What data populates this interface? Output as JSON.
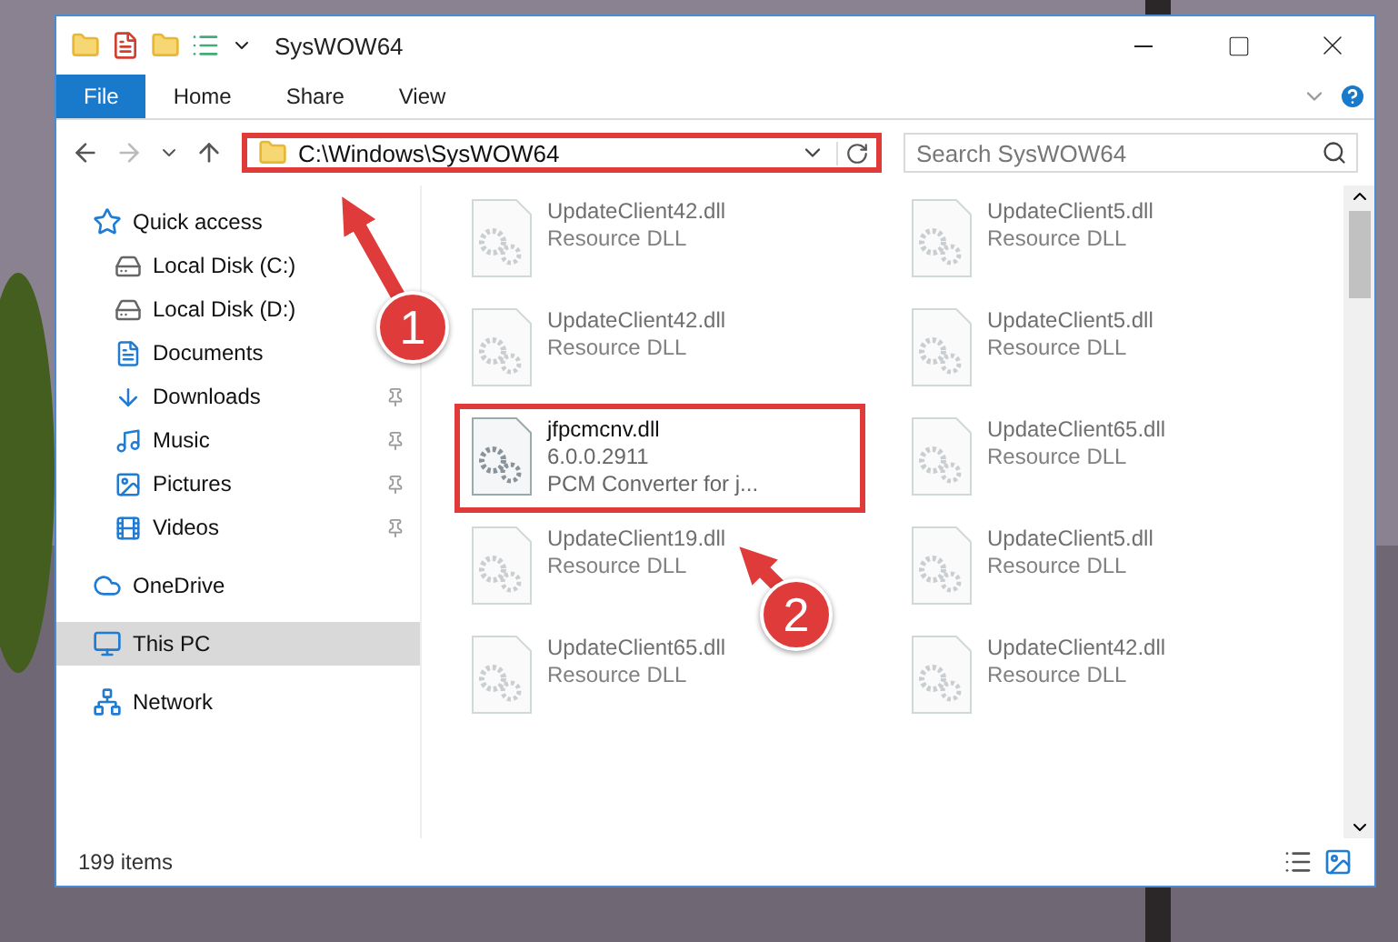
{
  "window": {
    "title": "SysWOW64"
  },
  "ribbon_tabs": [
    {
      "label": "File",
      "selected": true
    },
    {
      "label": "Home",
      "selected": false
    },
    {
      "label": "Share",
      "selected": false
    },
    {
      "label": "View",
      "selected": false
    }
  ],
  "address_bar": {
    "path": "C:\\Windows\\SysWOW64",
    "highlighted": true
  },
  "search": {
    "placeholder": "Search SysWOW64"
  },
  "navigation": [
    {
      "label": "Quick access",
      "selected": false,
      "children": [
        {
          "label": "Local Disk (C:)",
          "selected": false,
          "pinned": false
        },
        {
          "label": "Local Disk (D:)",
          "selected": false,
          "pinned": false
        },
        {
          "label": "Documents",
          "selected": false,
          "pinned": false
        },
        {
          "label": "Downloads",
          "selected": false,
          "pinned": true
        },
        {
          "label": "Music",
          "selected": false,
          "pinned": true
        },
        {
          "label": "Pictures",
          "selected": false,
          "pinned": true
        },
        {
          "label": "Videos",
          "selected": false,
          "pinned": true
        }
      ]
    },
    {
      "label": "OneDrive",
      "selected": false
    },
    {
      "label": "This PC",
      "selected": true
    },
    {
      "label": "Network",
      "selected": false
    }
  ],
  "files": [
    {
      "name": "UpdateClient42.dll",
      "details": [
        "Resource DLL"
      ],
      "blurred": true,
      "highlighted": false
    },
    {
      "name": "UpdateClient5.dll",
      "details": [
        "Resource DLL"
      ],
      "blurred": true,
      "highlighted": false
    },
    {
      "name": "UpdateClient42.dll",
      "details": [
        "Resource DLL"
      ],
      "blurred": true,
      "highlighted": false
    },
    {
      "name": "UpdateClient5.dll",
      "details": [
        "Resource DLL"
      ],
      "blurred": true,
      "highlighted": false
    },
    {
      "name": "jfpcmcnv.dll",
      "details": [
        "6.0.0.2911",
        "PCM Converter for j..."
      ],
      "blurred": false,
      "highlighted": true
    },
    {
      "name": "UpdateClient65.dll",
      "details": [
        "Resource DLL"
      ],
      "blurred": true,
      "highlighted": false
    },
    {
      "name": "UpdateClient19.dll",
      "details": [
        "Resource DLL"
      ],
      "blurred": true,
      "highlighted": false
    },
    {
      "name": "UpdateClient5.dll",
      "details": [
        "Resource DLL"
      ],
      "blurred": true,
      "highlighted": false
    },
    {
      "name": "UpdateClient65.dll",
      "details": [
        "Resource DLL"
      ],
      "blurred": true,
      "highlighted": false
    },
    {
      "name": "UpdateClient42.dll",
      "details": [
        "Resource DLL"
      ],
      "blurred": true,
      "highlighted": false
    }
  ],
  "status_bar": {
    "item_count": "199 items"
  },
  "annotations": [
    {
      "number": "1"
    },
    {
      "number": "2"
    }
  ]
}
